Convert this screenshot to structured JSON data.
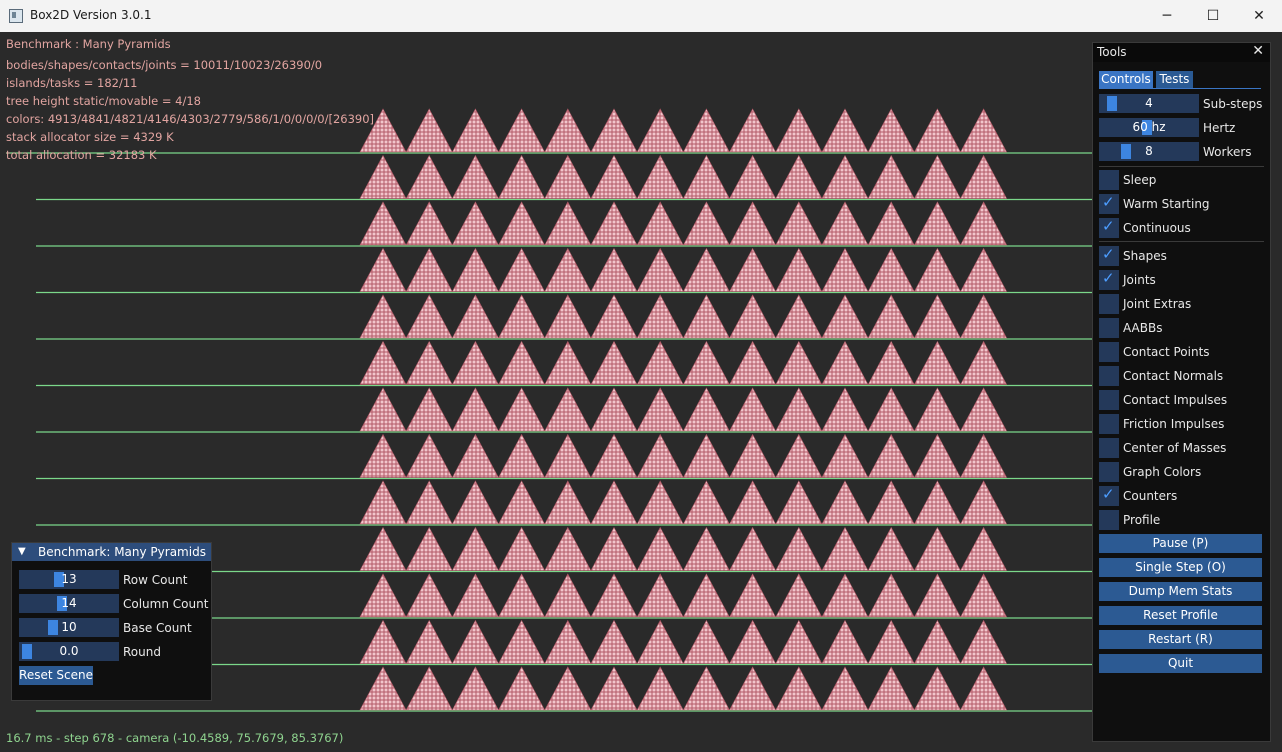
{
  "window": {
    "title": "Box2D Version 3.0.1",
    "buttons": {
      "minimize": "─",
      "maximize": "☐",
      "close": "✕"
    }
  },
  "stats": {
    "benchmark": "Benchmark : Many Pyramids",
    "counts": "bodies/shapes/contacts/joints = 10011/10023/26390/0",
    "islands": "islands/tasks = 182/11",
    "tree": "tree height static/movable = 4/18",
    "colors": "colors: 4913/4841/4821/4146/4303/2779/586/1/0/0/0/0/[26390]",
    "stack": "stack allocator size = 4329 K",
    "alloc": "total allocation = 32183 K"
  },
  "footer": "16.7 ms - step 678 - camera (-10.4589, 75.7679, 85.3767)",
  "scene": {
    "rows": 13,
    "pyramids_per_row": 14,
    "ground_color": "#7bd88a",
    "box_fill": "#f2c6cc",
    "box_edge": "#b25866"
  },
  "tools": {
    "title": "Tools",
    "close": "✕",
    "tabs": {
      "controls": "Controls",
      "tests": "Tests"
    },
    "sliders": {
      "substeps": {
        "value": "4",
        "label": "Sub-steps"
      },
      "hertz": {
        "value": "60 hz",
        "label": "Hertz"
      },
      "workers": {
        "value": "8",
        "label": "Workers"
      }
    },
    "checkboxes": [
      {
        "label": "Sleep",
        "checked": false
      },
      {
        "label": "Warm Starting",
        "checked": true
      },
      {
        "label": "Continuous",
        "checked": true
      },
      {
        "label": "Shapes",
        "checked": true
      },
      {
        "label": "Joints",
        "checked": true
      },
      {
        "label": "Joint Extras",
        "checked": false
      },
      {
        "label": "AABBs",
        "checked": false
      },
      {
        "label": "Contact Points",
        "checked": false
      },
      {
        "label": "Contact Normals",
        "checked": false
      },
      {
        "label": "Contact Impulses",
        "checked": false
      },
      {
        "label": "Friction Impulses",
        "checked": false
      },
      {
        "label": "Center of Masses",
        "checked": false
      },
      {
        "label": "Graph Colors",
        "checked": false
      },
      {
        "label": "Counters",
        "checked": true
      },
      {
        "label": "Profile",
        "checked": false
      }
    ],
    "check_glyph": "✓",
    "buttons": {
      "pause": "Pause (P)",
      "single_step": "Single Step (O)",
      "dump_mem": "Dump Mem Stats",
      "reset_profile": "Reset Profile",
      "restart": "Restart (R)",
      "quit": "Quit"
    }
  },
  "bench": {
    "title": "Benchmark: Many Pyramids",
    "collapse_icon": "▼",
    "row_count": {
      "value": "13",
      "label": "Row Count"
    },
    "column_count": {
      "value": "14",
      "label": "Column Count"
    },
    "base_count": {
      "value": "10",
      "label": "Base Count"
    },
    "round": {
      "value": "0.0",
      "label": "Round"
    },
    "reset_button": "Reset Scene"
  }
}
